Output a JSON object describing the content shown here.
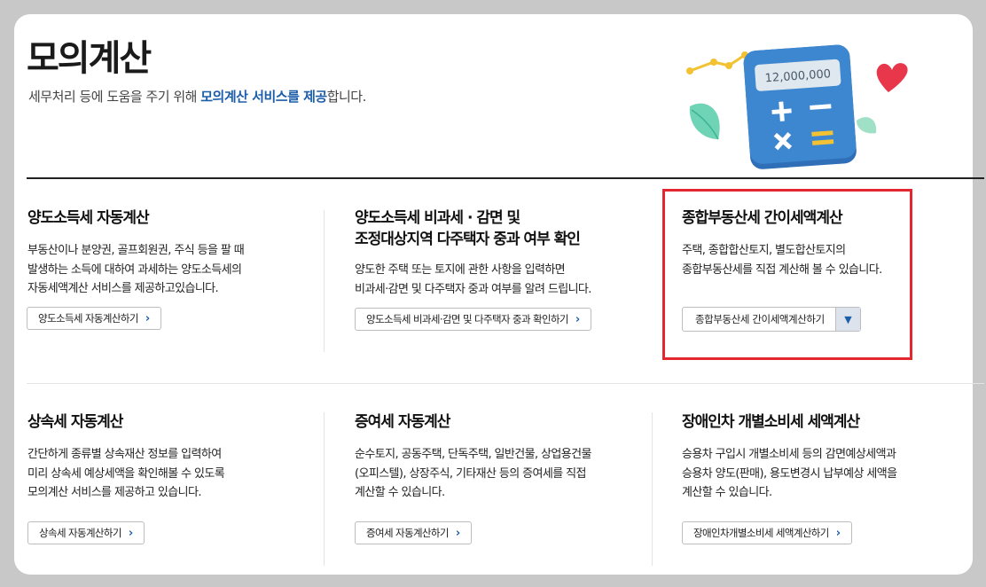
{
  "header": {
    "title": "모의계산",
    "subtitle_prefix": "세무처리 등에 도움을 주기 위해 ",
    "subtitle_highlight": "모의계산 서비스를 제공",
    "subtitle_suffix": "합니다.",
    "illustration_amount": "12,000,000"
  },
  "colors": {
    "accent": "#1d5ea8",
    "highlight_border": "#e3262f",
    "background": "#c8c8c8"
  },
  "services": [
    {
      "title": "양도소득세 자동계산",
      "description": "부동산이나 분양권, 골프회원권, 주식 등을 팔 때\n발생하는 소득에 대하여 과세하는 양도소득세의\n자동세액계산 서비스를 제공하고있습니다.",
      "button": "양도소득세 자동계산하기"
    },
    {
      "title": "양도소득세 비과세 · 감면 및\n조정대상지역 다주택자 중과 여부 확인",
      "description": "양도한 주택 또는 토지에 관한 사항을 입력하면\n비과세·감면 및 다주택자 중과 여부를 알려 드립니다.",
      "button": "양도소득세 비과세·감면 및 다주택자 중과 확인하기"
    },
    {
      "title": "종합부동산세 간이세액계산",
      "description": "주택, 종합합산토지, 별도합산토지의\n종합부동산세를 직접 계산해 볼 수 있습니다.",
      "button": "종합부동산세 간이세액계산하기"
    },
    {
      "title": "상속세 자동계산",
      "description": "간단하게 종류별 상속재산 정보를 입력하여\n미리 상속세 예상세액을 확인해볼 수 있도록\n모의계산 서비스를 제공하고 있습니다.",
      "button": "상속세 자동계산하기"
    },
    {
      "title": "증여세 자동계산",
      "description": "순수토지, 공동주택, 단독주택, 일반건물, 상업용건물\n(오피스텔), 상장주식, 기타재산 등의 증여세를 직접\n계산할 수 있습니다.",
      "button": "증여세 자동계산하기"
    },
    {
      "title": "장애인차 개별소비세 세액계산",
      "description": "승용차 구입시 개별소비세 등의 감면예상세액과\n승용차 양도(판매), 용도변경시 납부예상 세액을\n계산할 수 있습니다.",
      "button": "장애인차개별소비세 세액계산하기"
    }
  ]
}
